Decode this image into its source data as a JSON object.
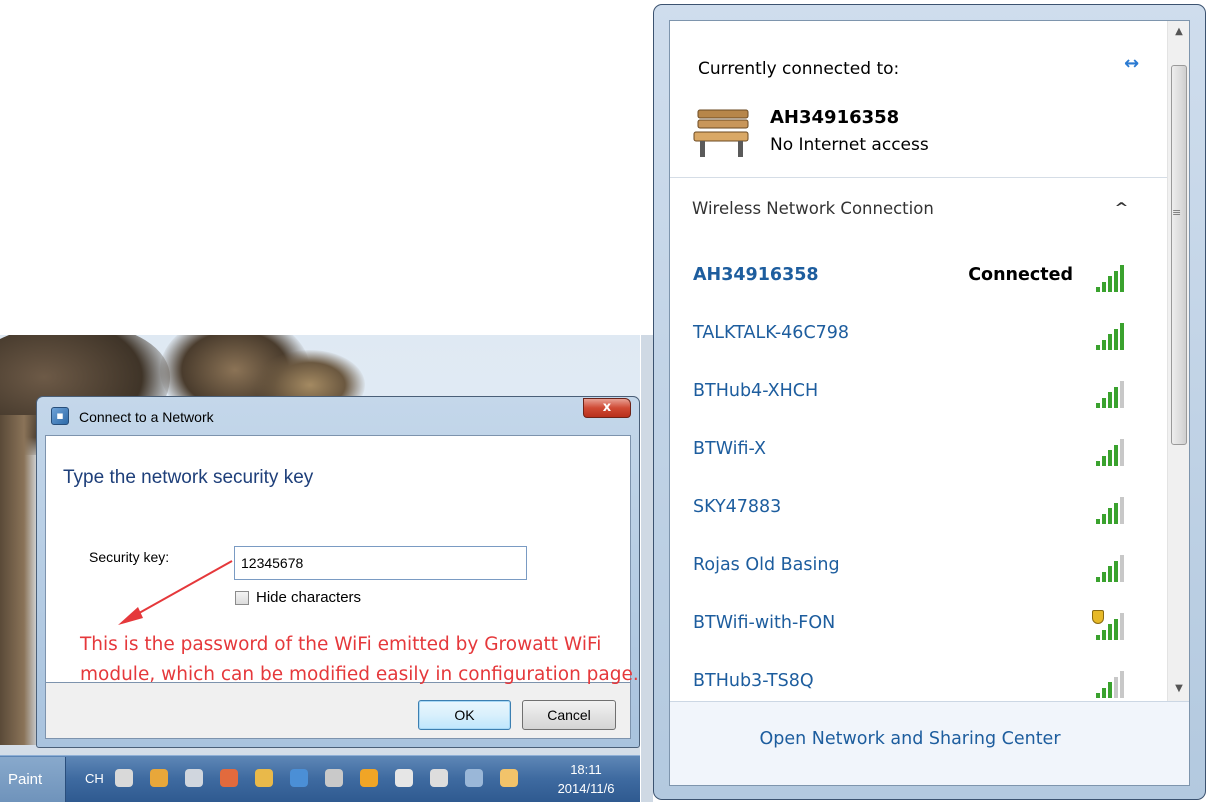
{
  "dialog": {
    "title": "Connect to a Network",
    "close_glyph": "x",
    "heading": "Type the network security key",
    "security_key_label": "Security key:",
    "security_key_value": "12345678",
    "hide_characters_label": "Hide characters",
    "hide_characters_checked": false,
    "ok_label": "OK",
    "cancel_label": "Cancel"
  },
  "annotation": {
    "text": "This is the password of the WiFi emitted by Growatt WiFi module, which can be modified easily in configuration page.",
    "color": "#e5383b"
  },
  "taskbar": {
    "app_label": "Paint",
    "language": "CH",
    "time": "18:11",
    "date": "2014/11/6",
    "tray_icons": [
      "keyboard-icon",
      "color-circle-icon",
      "bell-icon",
      "chrome-icon",
      "folder-icon",
      "photos-icon",
      "qq-penguin-icon",
      "orange-circle-icon",
      "volume-icon",
      "battery-icon",
      "network-icon",
      "messenger-icon"
    ]
  },
  "network_panel": {
    "currently_connected_label": "Currently connected to:",
    "current_network": "AH34916358",
    "current_status": "No Internet access",
    "section_title": "Wireless Network Connection",
    "networks": [
      {
        "name": "AH34916358",
        "status": "Connected",
        "bold": true,
        "signal": 5,
        "secured_warning": false
      },
      {
        "name": "TALKTALK-46C798",
        "status": "",
        "bold": false,
        "signal": 5,
        "secured_warning": false
      },
      {
        "name": "BTHub4-XHCH",
        "status": "",
        "bold": false,
        "signal": 4,
        "secured_warning": false
      },
      {
        "name": "BTWifi-X",
        "status": "",
        "bold": false,
        "signal": 4,
        "secured_warning": false
      },
      {
        "name": "SKY47883",
        "status": "",
        "bold": false,
        "signal": 4,
        "secured_warning": false
      },
      {
        "name": "Rojas Old Basing",
        "status": "",
        "bold": false,
        "signal": 4,
        "secured_warning": false
      },
      {
        "name": "BTWifi-with-FON",
        "status": "",
        "bold": false,
        "signal": 4,
        "secured_warning": true
      },
      {
        "name": "BTHub3-TS8Q",
        "status": "",
        "bold": false,
        "signal": 3,
        "secured_warning": false
      }
    ],
    "footer_link": "Open Network and Sharing Center",
    "accent_color": "#1d5d9e",
    "signal_color": "#3aa22e"
  }
}
